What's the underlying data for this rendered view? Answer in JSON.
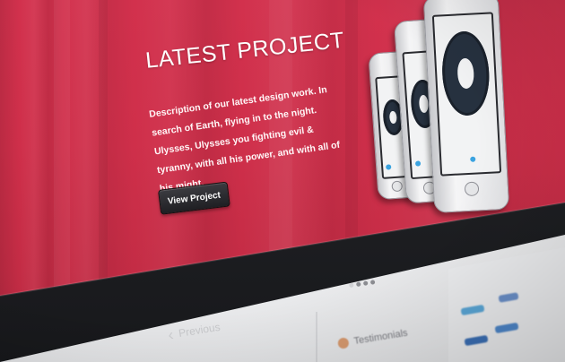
{
  "hero": {
    "title": "LATEST PROJECT",
    "description": "Description of our latest design work. In search of Earth, flying in to the night. Ulysses, Ulysses you fighting evil & tyranny, with all his power, and with all of his might.",
    "button_label": "View Project",
    "accent_color": "#d2314d"
  },
  "navigation": {
    "previous_label": "Previous",
    "previous_icon": "chevron-left-icon",
    "carousel_dots": 4
  },
  "lower": {
    "testimonials_label": "Testimonials",
    "testimonials_icon": "person-icon"
  }
}
